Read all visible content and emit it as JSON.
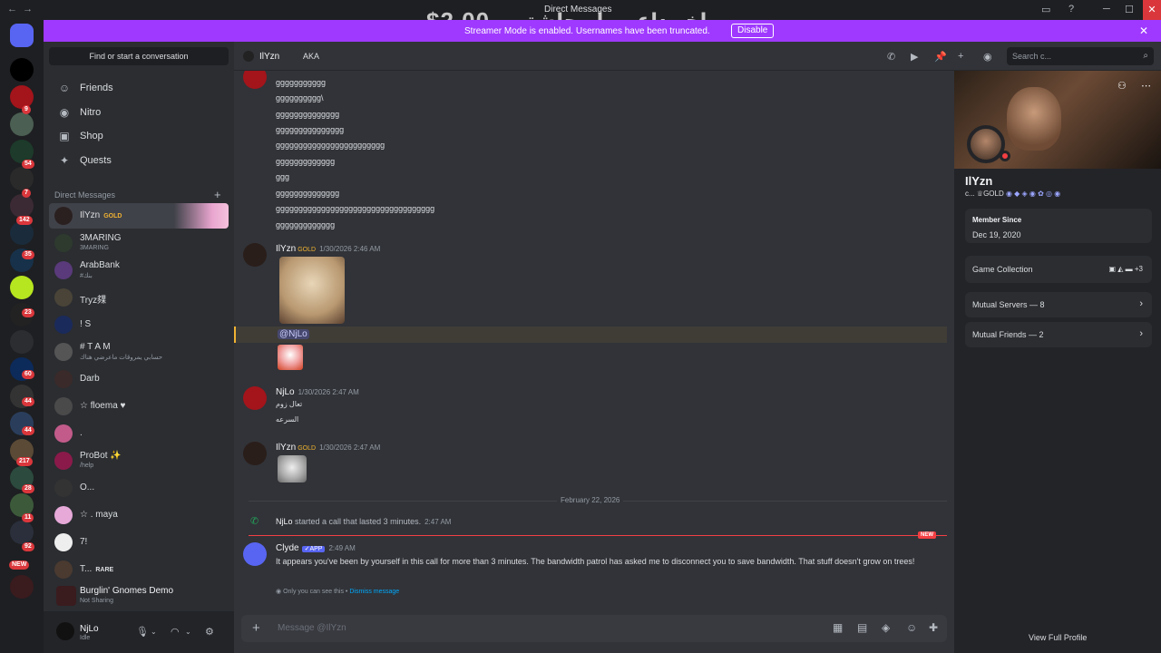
{
  "titlebar": {
    "nav_back": "←",
    "nav_fwd": "→",
    "title": "Direct Messages",
    "overlay_price": "$2.00",
    "overlay_arabic": "اخر داعم وله حلشته",
    "icons": [
      "inbox-icon",
      "help-icon",
      "minimize-icon",
      "maximize-icon",
      "close-icon"
    ]
  },
  "banner": {
    "text": "Streamer Mode is enabled. Usernames have been truncated.",
    "button": "Disable",
    "close": "✕"
  },
  "servers": [
    {
      "badge": ""
    },
    {
      "badge": ""
    },
    {
      "badge": "9"
    },
    {
      "badge": ""
    },
    {
      "badge": "54"
    },
    {
      "badge": "7"
    },
    {
      "badge": "142"
    },
    {
      "badge": "35"
    },
    {
      "badge": ""
    },
    {
      "badge": "23"
    },
    {
      "badge": ""
    },
    {
      "badge": "60"
    },
    {
      "badge": "44"
    },
    {
      "badge": "44"
    },
    {
      "badge": "217"
    },
    {
      "badge": "28"
    },
    {
      "badge": "11"
    },
    {
      "badge": "92"
    },
    {
      "badge": "NEW"
    },
    {
      "badge": "26"
    }
  ],
  "dms_sidebar": {
    "find_placeholder": "Find or start a conversation",
    "nav": [
      {
        "label": "Friends",
        "icon": "friends-icon"
      },
      {
        "label": "Nitro",
        "icon": "nitro-icon"
      },
      {
        "label": "Shop",
        "icon": "shop-icon"
      },
      {
        "label": "Quests",
        "icon": "quests-icon"
      }
    ],
    "header": "Direct Messages",
    "add": "+",
    "items": [
      {
        "name": "IlYzn",
        "tag": "GOLD",
        "sub": ""
      },
      {
        "name": "3MARING",
        "tag": "",
        "sub": "3MARING"
      },
      {
        "name": "ArabBank",
        "tag": "",
        "sub": "#بنك"
      },
      {
        "name": "Tryz㚌",
        "tag": "",
        "sub": ""
      },
      {
        "name": "! S",
        "tag": "",
        "sub": ""
      },
      {
        "name": "# T A M",
        "tag": "",
        "sub": "حسابي يمروقات ماعرضي هناك"
      },
      {
        "name": "Darb",
        "tag": "",
        "sub": ""
      },
      {
        "name": "☆ floema ♥",
        "tag": "",
        "sub": ""
      },
      {
        "name": ".",
        "tag": "",
        "sub": ""
      },
      {
        "name": "ProBot ✨",
        "tag": "",
        "sub": "/help"
      },
      {
        "name": "O...",
        "tag": "",
        "sub": ""
      },
      {
        "name": "☆ . maya",
        "tag": "",
        "sub": ""
      },
      {
        "name": "7!",
        "tag": "",
        "sub": ""
      },
      {
        "name": "T...",
        "tag": "RARE",
        "sub": ""
      }
    ]
  },
  "activity": {
    "title": "Burglin' Gnomes Demo",
    "subtitle": "Not Sharing"
  },
  "user": {
    "name": "NjLo",
    "status": "Idle"
  },
  "channel_header": {
    "name": "IlYzn",
    "aka": "AKA",
    "search_placeholder": "Search c..."
  },
  "messages": {
    "early_lines": [
      "ggggggggggg",
      "gggggggggg\\",
      "gggggggggggggg",
      "ggggggggggggggg",
      "gggggggggggggggggggggggg",
      "ggggggggggggg",
      "ggg",
      "gggggggggggggg",
      "ggggggggggggggggggggggggggggggggggg",
      "ggggggggggggg"
    ],
    "msg1": {
      "author": "IlYzn",
      "badge": "GOLD",
      "time": "1/30/2026 2:46 AM"
    },
    "mention": "@NjLo",
    "msg2": {
      "author": "NjLo",
      "time": "1/30/2026 2:47 AM",
      "line1": "تعال زوم",
      "line2": "السرعه"
    },
    "msg3": {
      "author": "IlYzn",
      "badge": "GOLD",
      "time": "1/30/2026 2:47 AM"
    },
    "date_divider": "February 22, 2026",
    "call": {
      "author": "NjLo",
      "text": "started a call that lasted 3 minutes.",
      "time": "2:47 AM"
    },
    "new_tag": "NEW",
    "clyde": {
      "author": "Clyde",
      "app": "✓APP",
      "time": "2:49 AM",
      "text": "It appears you've been by yourself in this call for more than 3 minutes. The bandwidth patrol has asked me to disconnect you to save bandwidth. That stuff doesn't grow on trees!",
      "ephemeral": "Only you can see this •",
      "dismiss": "Dismiss message"
    }
  },
  "composer": {
    "placeholder": "Message @IlYzn"
  },
  "profile": {
    "name": "IlYzn",
    "badges": "c... ♕GOLD",
    "member_since_label": "Member Since",
    "member_since": "Dec 19, 2020",
    "game_collection": "Game Collection",
    "game_more": "+3",
    "mutual_servers": "Mutual Servers — 8",
    "mutual_friends": "Mutual Friends — 2",
    "view_full": "View Full Profile"
  },
  "colors": {
    "accent": "#5865f2",
    "banner": "#9f39ff",
    "danger": "#f23f43",
    "gold": "#f0b232"
  }
}
